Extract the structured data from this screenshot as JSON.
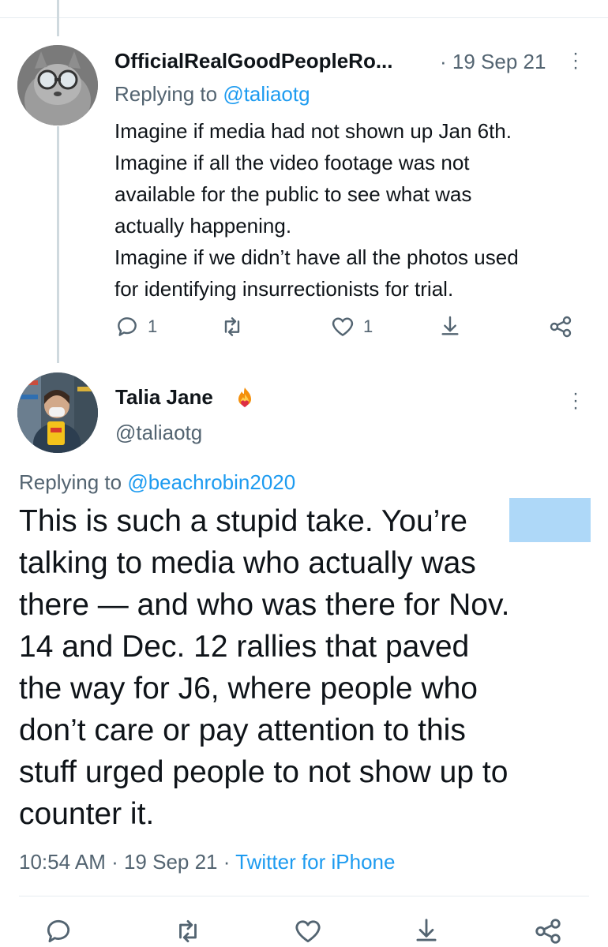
{
  "parent_tweet": {
    "display_name": "OfficialRealGoodPeopleRo...",
    "date": "· 19 Sep 21",
    "replying_prefix": "Replying to",
    "replying_to": "@taliaotg",
    "lines": [
      "Imagine if media had not shown up Jan 6th.",
      "Imagine if all the video footage was not",
      "available for the public to see what was",
      "actually happening.",
      "Imagine if we didn’t have all the photos used",
      "for identifying insurrectionists for trial."
    ],
    "reply_count": "1",
    "like_count": "1"
  },
  "main_tweet": {
    "display_name": "Talia Jane",
    "handle": "@taliaotg",
    "replying_prefix": "Replying to",
    "replying_to": "@beachrobin2020",
    "lines": [
      "This is such a stupid take. You’re",
      "talking to media who actually was",
      "there — and who was there for Nov.",
      "14 and Dec. 12 rallies that paved",
      "the way for J6, where people who",
      "don’t care or pay attention to this",
      "stuff urged people to not show up to",
      "counter it."
    ],
    "time": "10:54 AM · 19 Sep 21 · ",
    "source": "Twitter for iPhone"
  },
  "icons": {
    "reply": "reply-icon",
    "retweet": "retweet-icon",
    "like": "heart-icon",
    "share": "share-icon",
    "network": "share-network-icon",
    "more": "more-dots-icon",
    "badge": "fire-heart-badge-icon"
  },
  "colors": {
    "link": "#1d9bf0",
    "muted": "#536471",
    "text": "#0f1419",
    "redaction": "#aed8f8"
  }
}
